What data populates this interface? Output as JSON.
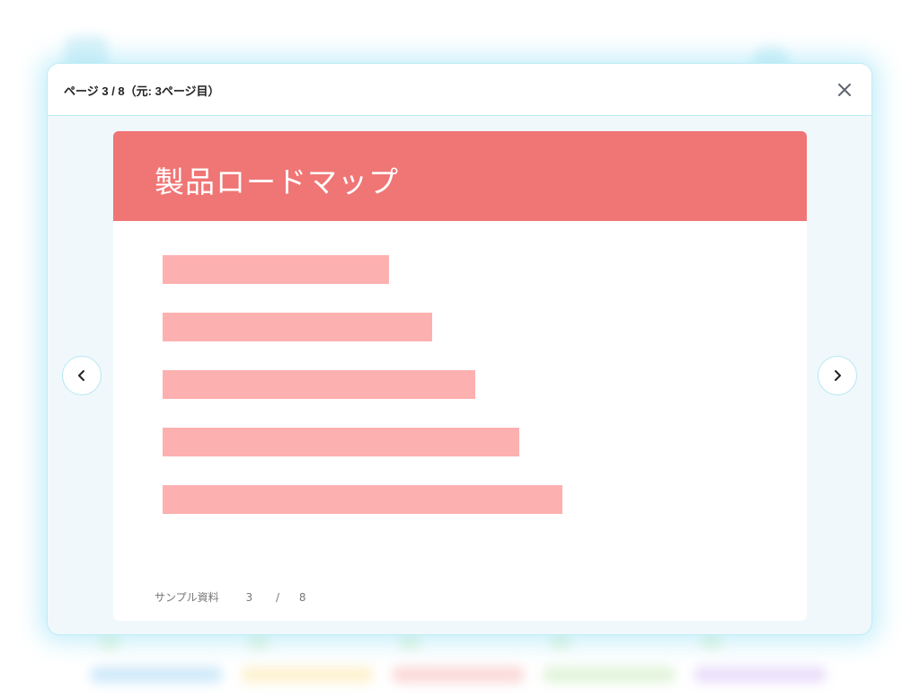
{
  "modal": {
    "title": "ページ 3 / 8（元: 3ページ目）",
    "close_icon": "close-icon",
    "prev_icon": "chevron-left-icon",
    "next_icon": "chevron-right-icon"
  },
  "slide": {
    "title": "製品ロードマップ",
    "footer_label": "サンプル資料",
    "page_current": "3",
    "page_separator": "/",
    "page_total": "8",
    "bar_levels": [
      0.52,
      0.62,
      0.72,
      0.82,
      0.92
    ]
  },
  "colors": {
    "slide_header": "#f07575",
    "bar": "#fdb0b0",
    "modal_border": "#bdecf4",
    "pill_colors": [
      "#a9d8f5",
      "#fbe7a9",
      "#f9b9b9",
      "#c9ebbd",
      "#d9c4f5"
    ]
  }
}
